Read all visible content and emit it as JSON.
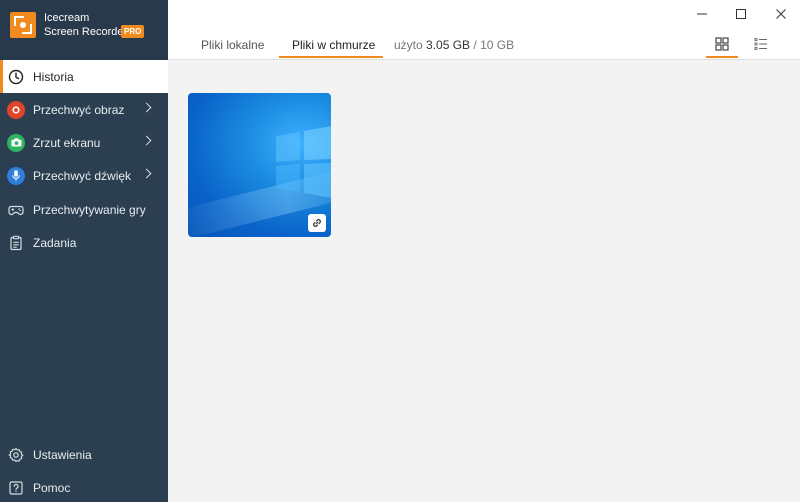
{
  "app": {
    "name": "Icecream",
    "subtitle": "Screen Recorder",
    "badge": "PRO",
    "accent_color": "#f18a1f",
    "sidebar_color": "#2b3f50"
  },
  "sidebar": {
    "items": [
      {
        "label": "Historia",
        "icon": "clock-icon",
        "active": true
      },
      {
        "label": "Przechwyć obraz",
        "icon": "record-icon",
        "submenu": true
      },
      {
        "label": "Zrzut ekranu",
        "icon": "camera-icon",
        "submenu": true
      },
      {
        "label": "Przechwyć dźwięk",
        "icon": "microphone-icon",
        "submenu": true
      },
      {
        "label": "Przechwytywanie gry",
        "icon": "gamepad-icon"
      },
      {
        "label": "Zadania",
        "icon": "tasks-icon"
      }
    ],
    "bottom": [
      {
        "label": "Ustawienia",
        "icon": "gear-icon"
      },
      {
        "label": "Pomoc",
        "icon": "help-icon"
      }
    ]
  },
  "header": {
    "tabs": [
      {
        "label": "Pliki lokalne",
        "active": false
      },
      {
        "label": "Pliki w chmurze",
        "active": true
      }
    ],
    "usage_prefix": "użyto",
    "usage_used": "3.05 GB",
    "usage_total": "/ 10 GB",
    "view_modes": [
      "grid-view-icon",
      "list-view-icon"
    ],
    "active_view": "grid"
  },
  "window_controls": [
    "minimize-icon",
    "maximize-icon",
    "close-icon"
  ],
  "files": [
    {
      "thumbnail": "windows-desktop-thumbnail",
      "badge_icon": "link-icon"
    }
  ]
}
